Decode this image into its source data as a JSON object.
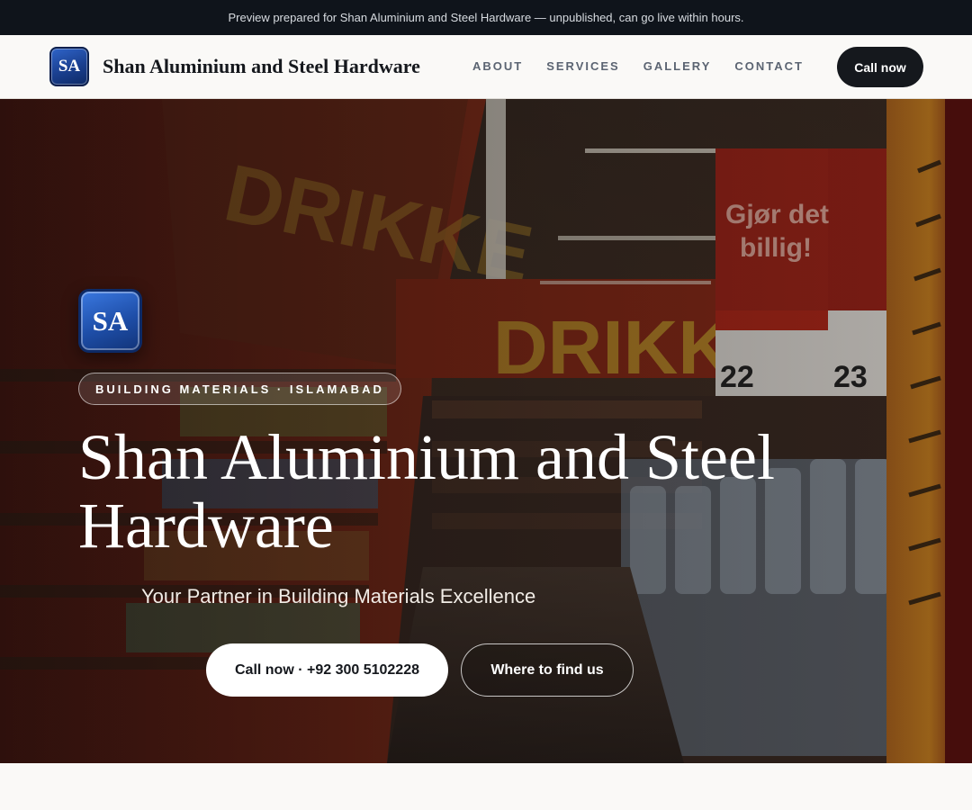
{
  "banner": {
    "text": "Preview prepared for Shan Aluminium and Steel Hardware — unpublished, can go live within hours."
  },
  "nav": {
    "logo_initials": "SA",
    "brand": "Shan Aluminium and Steel Hardware",
    "links": [
      "ABOUT",
      "SERVICES",
      "GALLERY",
      "CONTACT"
    ],
    "cta_label": "Call now"
  },
  "hero": {
    "logo_initials": "SA",
    "eyebrow": "BUILDING MATERIALS · ISLAMABAD",
    "title": "Shan Aluminium and Steel Hardware",
    "subtitle": "Your Partner in Building Materials Excellence",
    "primary_cta": "Call now · +92 300 5102228",
    "secondary_cta": "Where to find us",
    "background_image": "supermarket-aisle-photo",
    "colors": {
      "brand_blue": "#1e4ea8",
      "dark": "#15181d",
      "banner_bg": "#0f141b"
    }
  }
}
